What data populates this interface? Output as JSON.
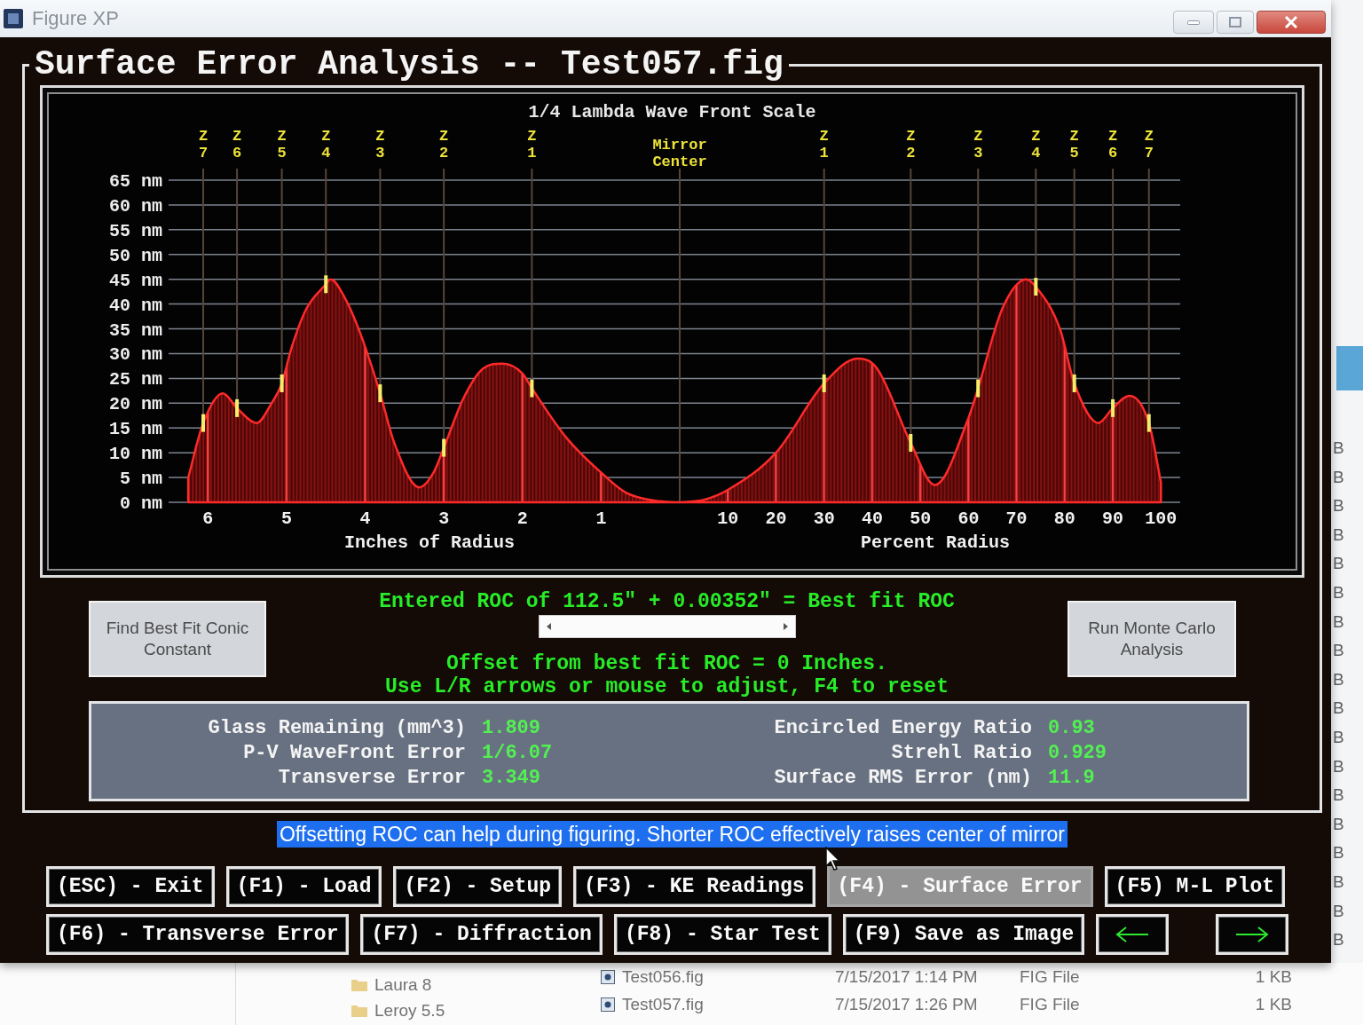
{
  "window": {
    "title": "Figure XP"
  },
  "heading": "Surface Error Analysis -- Test057.fig",
  "chart_panel": {
    "title": "1/4 Lambda Wave Front Scale",
    "charts": [
      {
        "chart_data": {
          "type": "area",
          "xlabel": "Inches of Radius",
          "x": [
            6.25,
            6.06,
            5.81,
            5.63,
            5.38,
            5.19,
            5.06,
            4.94,
            4.75,
            4.5,
            4.44,
            4.25,
            4.06,
            3.81,
            3.63,
            3.31,
            3.13,
            3.0,
            2.75,
            2.5,
            2.25,
            2.0,
            1.88,
            1.44,
            1.0,
            0.69,
            0.31,
            0
          ],
          "series": [
            {
              "color": "#ff2a2a",
              "values": [
                5,
                16,
                22,
                19,
                16,
                20,
                24,
                31,
                39,
                44,
                45,
                41,
                34,
                22,
                12,
                3,
                6,
                11,
                21,
                27,
                28,
                26,
                23,
                13,
                6,
                2,
                0.3,
                0
              ]
            }
          ],
          "xlim": [
            6.5,
            0
          ],
          "ylim": [
            0,
            65
          ],
          "grid": true,
          "xticks": [
            6,
            5,
            4,
            3,
            2,
            1
          ],
          "yticks": [
            {
              "value": 0,
              "label": "0 nm"
            },
            {
              "value": 5,
              "label": "5 nm"
            },
            {
              "value": 10,
              "label": "10 nm"
            },
            {
              "value": 15,
              "label": "15 nm"
            },
            {
              "value": 20,
              "label": "20 nm"
            },
            {
              "value": 25,
              "label": "25 nm"
            },
            {
              "value": 30,
              "label": "30 nm"
            },
            {
              "value": 35,
              "label": "35 nm"
            },
            {
              "value": 40,
              "label": "40 nm"
            },
            {
              "value": 45,
              "label": "45 nm"
            },
            {
              "value": 50,
              "label": "50 nm"
            },
            {
              "value": 55,
              "label": "55 nm"
            },
            {
              "value": 60,
              "label": "60 nm"
            },
            {
              "value": 65,
              "label": "65 nm"
            }
          ],
          "ref_lines": [
            {
              "axis": "x",
              "value": 6.06,
              "label": "Z 7"
            },
            {
              "axis": "x",
              "value": 5.63,
              "label": "Z 6"
            },
            {
              "axis": "x",
              "value": 5.06,
              "label": "Z 5"
            },
            {
              "axis": "x",
              "value": 4.5,
              "label": "Z 4"
            },
            {
              "axis": "x",
              "value": 3.81,
              "label": "Z 3"
            },
            {
              "axis": "x",
              "value": 3.0,
              "label": "Z 2"
            },
            {
              "axis": "x",
              "value": 1.88,
              "label": "Z 1"
            }
          ]
        }
      },
      {
        "chart_data": {
          "type": "area",
          "xlabel": "Percent Radius",
          "x": [
            0,
            5,
            10,
            20,
            30,
            37,
            41,
            48,
            53,
            60,
            62,
            67,
            72,
            74,
            79,
            82,
            87,
            90,
            93.5,
            97.5,
            100
          ],
          "series": [
            {
              "color": "#ff2a2a",
              "values": [
                0,
                0.5,
                2.5,
                10,
                24,
                29,
                27,
                12,
                3.5,
                17,
                23,
                39,
                45,
                43.5,
                35,
                24,
                16,
                19,
                21.5,
                16,
                4
              ]
            }
          ],
          "xlim": [
            0,
            104
          ],
          "ylim": [
            0,
            65
          ],
          "grid": true,
          "xticks": [
            10,
            20,
            30,
            40,
            50,
            60,
            70,
            80,
            90,
            100
          ],
          "ref_lines": [
            {
              "axis": "x",
              "value": 0,
              "label": "Mirror Center"
            },
            {
              "axis": "x",
              "value": 30,
              "label": "Z 1"
            },
            {
              "axis": "x",
              "value": 48,
              "label": "Z 2"
            },
            {
              "axis": "x",
              "value": 62,
              "label": "Z 3"
            },
            {
              "axis": "x",
              "value": 74,
              "label": "Z 4"
            },
            {
              "axis": "x",
              "value": 82,
              "label": "Z 5"
            },
            {
              "axis": "x",
              "value": 90,
              "label": "Z 6"
            },
            {
              "axis": "x",
              "value": 97.5,
              "label": "Z 7"
            }
          ]
        }
      }
    ]
  },
  "roc": {
    "best_fit_button": "Find Best Fit Conic Constant",
    "monte_carlo_button": "Run Monte Carlo Analysis",
    "entered": "Entered ROC of 112.5\" + 0.00352\" = Best fit ROC",
    "offset": "Offset from best fit ROC = 0 Inches.",
    "instructions": "Use L/R arrows or mouse to adjust, F4 to reset"
  },
  "stats": {
    "left": [
      {
        "label": "Glass Remaining (mm^3)",
        "value": "1.809"
      },
      {
        "label": "P-V WaveFront Error",
        "value": "1/6.07"
      },
      {
        "label": "Transverse Error",
        "value": "3.349"
      }
    ],
    "right": [
      {
        "label": "Encircled Energy Ratio",
        "value": "0.93"
      },
      {
        "label": "Strehl Ratio",
        "value": "0.929"
      },
      {
        "label": "Surface RMS Error (nm)",
        "value": "11.9"
      }
    ]
  },
  "hint": "Offsetting ROC can help during figuring. Shorter ROC effectively raises center of mirror",
  "button_rows": [
    {
      "buttons": [
        {
          "kind": "text",
          "label": "(ESC) - Exit",
          "disabled": false
        },
        {
          "kind": "text",
          "label": "(F1) - Load",
          "disabled": false
        },
        {
          "kind": "text",
          "label": "(F2) - Setup",
          "disabled": false
        },
        {
          "kind": "text",
          "label": "(F3) - KE Readings",
          "disabled": false
        },
        {
          "kind": "text",
          "label": "(F4) - Surface Error",
          "disabled": true
        },
        {
          "kind": "text",
          "label": "(F5) M-L Plot",
          "disabled": false
        }
      ]
    },
    {
      "buttons": [
        {
          "kind": "text",
          "label": "(F6) - Transverse Error",
          "disabled": false
        },
        {
          "kind": "text",
          "label": "(F7) - Diffraction",
          "disabled": false
        },
        {
          "kind": "text",
          "label": "(F8) - Star Test",
          "disabled": false
        },
        {
          "kind": "text",
          "label": "(F9) Save as Image",
          "disabled": false
        },
        {
          "kind": "left",
          "disabled": false
        },
        {
          "kind": "right",
          "disabled": false
        }
      ]
    }
  ],
  "background_window": {
    "size_column": [
      "B",
      "B",
      "B",
      "B",
      "B",
      "B",
      "B",
      "B",
      "B",
      "B",
      "B",
      "B",
      "B",
      "B",
      "B",
      "B",
      "B",
      "B"
    ],
    "folders": [
      "Laura 8",
      "Leroy 5.5"
    ],
    "files": [
      {
        "name": "Test056.fig",
        "modified": "7/15/2017 1:14 PM",
        "type": "FIG File",
        "size": "1 KB"
      },
      {
        "name": "Test057.fig",
        "modified": "7/15/2017 1:26 PM",
        "type": "FIG File",
        "size": "1 KB"
      }
    ]
  }
}
